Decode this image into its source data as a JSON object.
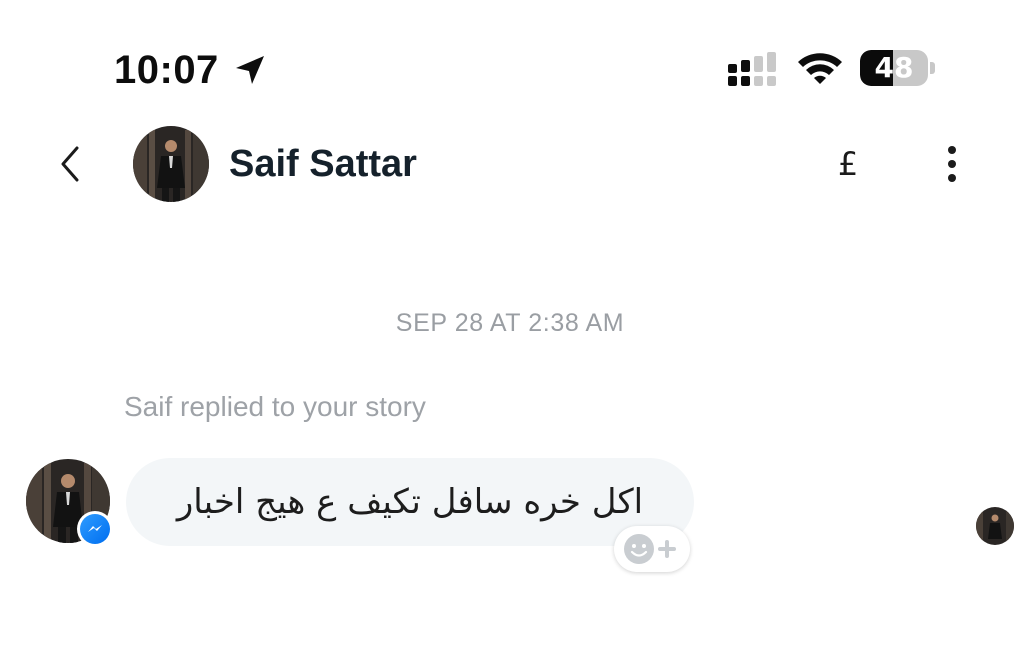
{
  "status_bar": {
    "time": "10:07",
    "battery_text": "48",
    "battery_level": 0.48,
    "icons": [
      "location-arrow-icon",
      "cellular-signal-icon",
      "wifi-icon",
      "battery-icon"
    ]
  },
  "header": {
    "contact_name": "Saif Sattar",
    "pound_symbol": "£",
    "icons": [
      "back-chevron-icon",
      "more-vertical-icon"
    ]
  },
  "conversation": {
    "timestamp": "SEP 28 AT 2:38 AM",
    "reply_note": "Saif replied to your story",
    "message": {
      "text": "اكل خره سافل تكيف ع هيج اخبار",
      "icons": [
        "messenger-badge-icon",
        "add-reaction-icon"
      ]
    }
  },
  "colors": {
    "bubble_bg": "#f3f6f8",
    "muted_text": "#9ea2a7",
    "name_text": "#15212b",
    "messenger_blue": "#0a7cff"
  }
}
